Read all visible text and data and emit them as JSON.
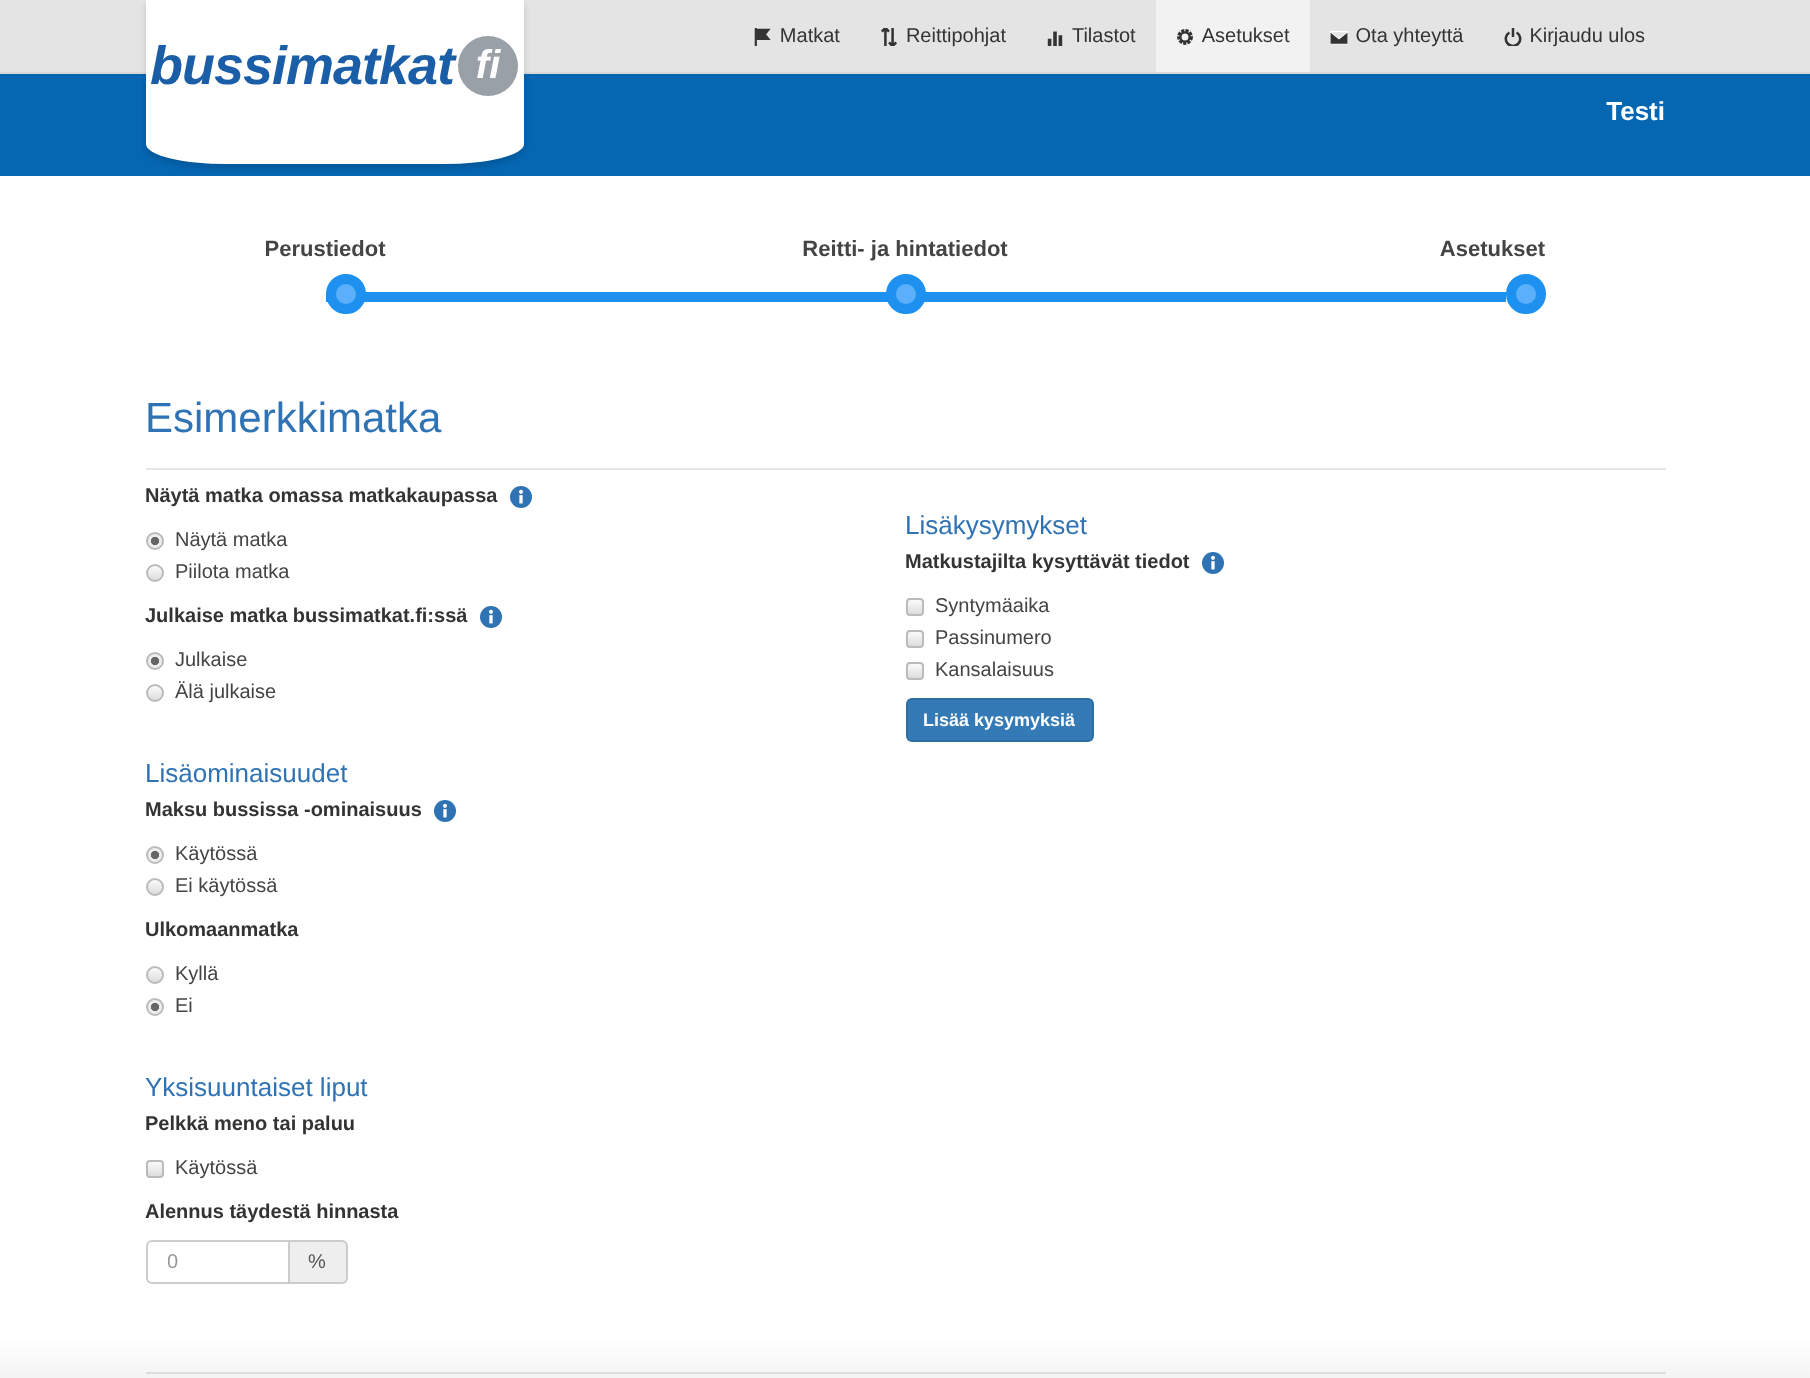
{
  "logo": {
    "text": "bussimatkat",
    "badge": "fi"
  },
  "nav": [
    {
      "label": "Matkat",
      "selected": false
    },
    {
      "label": "Reittipohjat",
      "selected": false
    },
    {
      "label": "Tilastot",
      "selected": false
    },
    {
      "label": "Asetukset",
      "selected": true
    },
    {
      "label": "Ota yhteyttä",
      "selected": false
    },
    {
      "label": "Kirjaudu ulos",
      "selected": false
    }
  ],
  "header": {
    "user": "Testi"
  },
  "steps": [
    {
      "label": "Perustiedot"
    },
    {
      "label": "Reitti- ja hintatiedot"
    },
    {
      "label": "Asetukset"
    }
  ],
  "title": "Esimerkkimatka",
  "left": [
    {
      "fields": [
        {
          "kind": "radio",
          "label": "Näytä matka omassa matkakaupassa",
          "info": true,
          "options": [
            {
              "label": "Näytä matka",
              "checked": true
            },
            {
              "label": "Piilota matka",
              "checked": false
            }
          ]
        },
        {
          "kind": "radio",
          "label": "Julkaise matka bussimatkat.fi:ssä",
          "info": true,
          "options": [
            {
              "label": "Julkaise",
              "checked": true
            },
            {
              "label": "Älä julkaise",
              "checked": false
            }
          ]
        }
      ]
    },
    {
      "heading": "Lisäominaisuudet",
      "fields": [
        {
          "kind": "radio",
          "label": "Maksu bussissa -ominaisuus",
          "info": true,
          "options": [
            {
              "label": "Käytössä",
              "checked": true
            },
            {
              "label": "Ei käytössä",
              "checked": false
            }
          ]
        },
        {
          "kind": "radio",
          "label": "Ulkomaanmatka",
          "info": false,
          "options": [
            {
              "label": "Kyllä",
              "checked": false
            },
            {
              "label": "Ei",
              "checked": true
            }
          ]
        }
      ]
    },
    {
      "heading": "Yksisuuntaiset liput",
      "fields": [
        {
          "kind": "checkbox",
          "label": "Pelkkä meno tai paluu",
          "info": false,
          "options": [
            {
              "label": "Käytössä",
              "checked": false
            }
          ]
        },
        {
          "kind": "input",
          "label": "Alennus täydestä hinnasta",
          "info": false,
          "placeholder": "0",
          "addon": "%"
        }
      ]
    }
  ],
  "right": {
    "heading": "Lisäkysymykset",
    "label": "Matkustajilta kysyttävät tiedot",
    "info": true,
    "options": [
      {
        "label": "Syntymäaika",
        "checked": false
      },
      {
        "label": "Passinumero",
        "checked": false
      },
      {
        "label": "Kansalaisuus",
        "checked": false
      }
    ],
    "button": "Lisää kysymyksiä"
  }
}
